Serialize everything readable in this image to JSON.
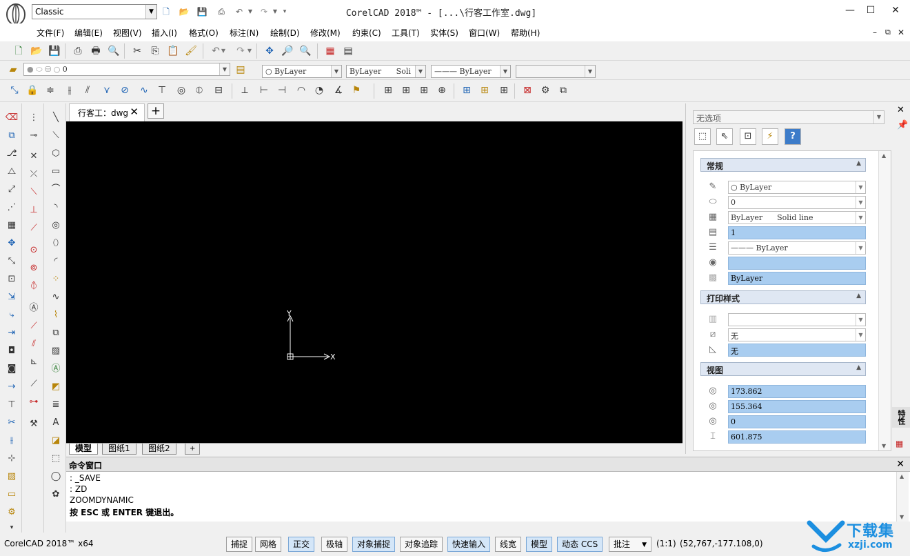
{
  "title_bar": {
    "workspace": "Classic",
    "title": "CorelCAD 2018™ - [...\\行客工作室.dwg]"
  },
  "menu": {
    "items": [
      "文件(F)",
      "编辑(E)",
      "视图(V)",
      "插入(I)",
      "格式(O)",
      "标注(N)",
      "绘制(D)",
      "修改(M)",
      "约束(C)",
      "工具(T)",
      "实体(S)",
      "窗口(W)",
      "帮助(H)"
    ]
  },
  "layer_bar": {
    "layer_value": "0",
    "color_value": "ByLayer",
    "linetype_value": "ByLayer",
    "linetype_suffix": "Soli",
    "lineweight_value": "——— ByLayer"
  },
  "document": {
    "tab_label": "行客工：dwg",
    "axis_x": "X",
    "axis_y": "Y",
    "layout_tabs": [
      "模型",
      "图纸1",
      "图纸2",
      "+"
    ]
  },
  "properties": {
    "selection": "无选项",
    "sections": {
      "general": "常规",
      "print_style": "打印样式",
      "view": "视图"
    },
    "general_rows": [
      "ByLayer",
      "0",
      "ByLayer      Solid line",
      "1",
      "——— ByLayer",
      "",
      "ByLayer"
    ],
    "print_rows": [
      "",
      "无",
      "无"
    ],
    "view_rows": [
      "173.862",
      "155.364",
      "0",
      "601.875"
    ],
    "side_label": "特性"
  },
  "command_window": {
    "title": "命令窗口",
    "lines": [
      ": _SAVE",
      ": ZD",
      "ZOOMDYNAMIC",
      "按 ESC 或 ENTER 键退出。"
    ]
  },
  "status_bar": {
    "app": "CorelCAD 2018™ x64",
    "buttons": [
      "捕捉",
      "网格",
      "正交",
      "极轴",
      "对象捕捉",
      "对象追踪",
      "快速输入",
      "线宽",
      "模型",
      "动态 CCS"
    ],
    "annotation": "批注",
    "scale": "(1:1)",
    "coords": "(52,767,-177.108,0)"
  },
  "watermark": {
    "text": "下载集",
    "url": "xzji.com"
  }
}
